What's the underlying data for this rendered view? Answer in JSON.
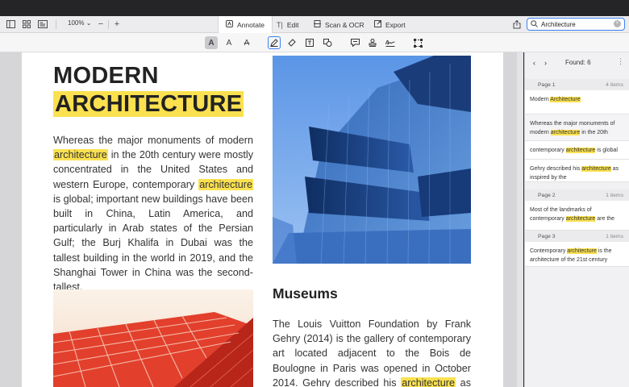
{
  "toolbar": {
    "zoom": "100%",
    "tabs": [
      {
        "label": "Annotate"
      },
      {
        "label": "Edit"
      },
      {
        "label": "Scan & OCR"
      },
      {
        "label": "Export"
      }
    ],
    "search": {
      "value": "Architecture",
      "placeholder": "Search"
    }
  },
  "document": {
    "title_line1": "MODERN",
    "title_line2": "ARCHITECTURE",
    "p1": [
      {
        "t": "Whereas the major monuments of modern "
      },
      {
        "t": "architecture",
        "hl": true
      },
      {
        "t": " in the 20th century were mostly concentrated in the United States and western Europe, contemporary "
      },
      {
        "t": "architecture",
        "hl": true
      },
      {
        "t": " is global; important new buildings have been built in China, Latin America, and particularly in Arab states of the Persian Gulf; the Burj Khalifa in Dubai was the tallest building in the world in 2019, and the Shanghai Tower in China was the second-tallest."
      }
    ],
    "heading2": "Museums",
    "p2": [
      {
        "t": "The Louis Vuitton Foundation by Frank Gehry (2014) is the gallery of contemporary art located adjacent to the Bois de Boulogne in Paris was opened in October 2014. Gehry described his "
      },
      {
        "t": "architecture",
        "hl": true
      },
      {
        "t": " as inspired by the"
      }
    ]
  },
  "panel": {
    "found": "Found: 6",
    "groups": [
      {
        "page": "Page 1",
        "count": "4 items",
        "results": [
          [
            {
              "t": "Modern "
            },
            {
              "t": "Architecture",
              "hl": true
            }
          ],
          [
            {
              "t": "Whereas the major monuments of modern "
            },
            {
              "t": "architecture",
              "hl": true
            },
            {
              "t": " in the 20th"
            }
          ],
          [
            {
              "t": "contemporary "
            },
            {
              "t": "architecture",
              "hl": true
            },
            {
              "t": " is global"
            }
          ],
          [
            {
              "t": "Gehry described his "
            },
            {
              "t": "architecture",
              "hl": true
            },
            {
              "t": " as inspired by the"
            }
          ]
        ]
      },
      {
        "page": "Page 2",
        "count": "1 items",
        "results": [
          [
            {
              "t": "Most of the landmarks of contemporary "
            },
            {
              "t": "architecture",
              "hl": true
            },
            {
              "t": " are the"
            }
          ]
        ]
      },
      {
        "page": "Page 3",
        "count": "1 items",
        "results": [
          [
            {
              "t": "Contemporary "
            },
            {
              "t": "architecture",
              "hl": true
            },
            {
              "t": " is the architecture of the 21st century"
            }
          ]
        ]
      }
    ]
  },
  "colors": {
    "highlight": "#fbe150",
    "accent": "#3b82f6"
  },
  "icons": [
    "sidebar-icon",
    "grid-icon",
    "page-view-icon",
    "zoom-out-icon",
    "zoom-in-icon",
    "annotate-icon",
    "edit-text-icon",
    "scan-icon",
    "export-icon",
    "share-icon",
    "search-icon",
    "clear-icon",
    "text-highlight-icon",
    "text-font-icon",
    "strikethrough-icon",
    "pen-icon",
    "eraser-icon",
    "textbox-icon",
    "shapes-icon",
    "comment-icon",
    "stamp-icon",
    "signature-icon",
    "crop-icon",
    "prev-icon",
    "next-icon",
    "more-icon"
  ]
}
